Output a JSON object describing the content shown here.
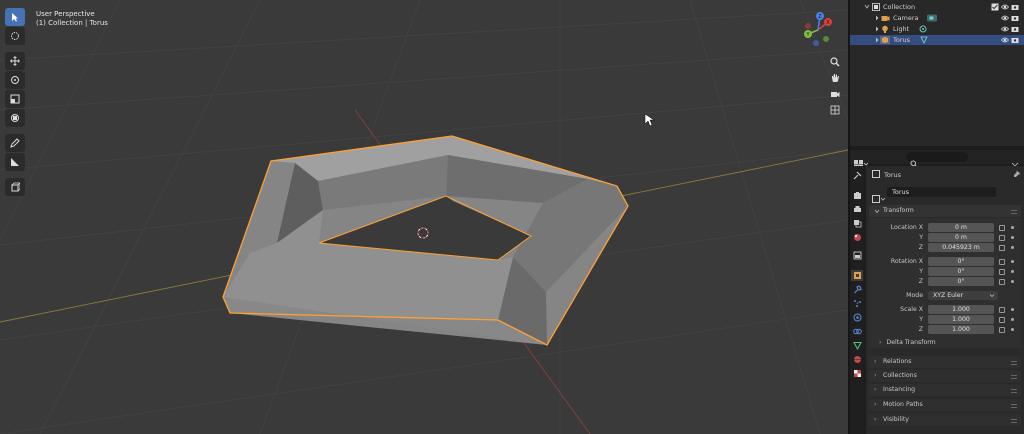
{
  "viewport": {
    "perspective_label": "User Perspective",
    "collection_label": "(1) Collection | Torus",
    "gizmo_axes": [
      "X",
      "Y",
      "Z"
    ]
  },
  "outliner": {
    "rows": [
      {
        "label": "Collection",
        "icon": "collection-icon"
      },
      {
        "label": "Camera",
        "icon": "camera-object-icon"
      },
      {
        "label": "Light",
        "icon": "light-object-icon"
      },
      {
        "label": "Torus",
        "icon": "mesh-object-icon",
        "selected": true
      }
    ]
  },
  "properties": {
    "object_name": "Torus",
    "data_name": "Torus",
    "transform": {
      "title": "Transform",
      "location_label": "Location X",
      "rotation_label": "Rotation X",
      "scale_label": "Scale X",
      "y_label": "Y",
      "z_label": "Z",
      "location": [
        "0 m",
        "0 m",
        "0.045923 m"
      ],
      "rotation": [
        "0°",
        "0°",
        "0°"
      ],
      "mode_label": "Mode",
      "mode_value": "XYZ Euler",
      "scale": [
        "1.000",
        "1.000",
        "1.000"
      ],
      "delta_transform": "Delta Transform"
    },
    "panels": [
      "Relations",
      "Collections",
      "Instancing",
      "Motion Paths",
      "Visibility"
    ]
  },
  "colors": {
    "selection_outline": "#ffa033",
    "selected_row": "#334d80",
    "active_tool": "#4772b3",
    "x_axis": "#d9403b",
    "y_axis": "#7fbf3f",
    "z_axis": "#4c83e6"
  }
}
